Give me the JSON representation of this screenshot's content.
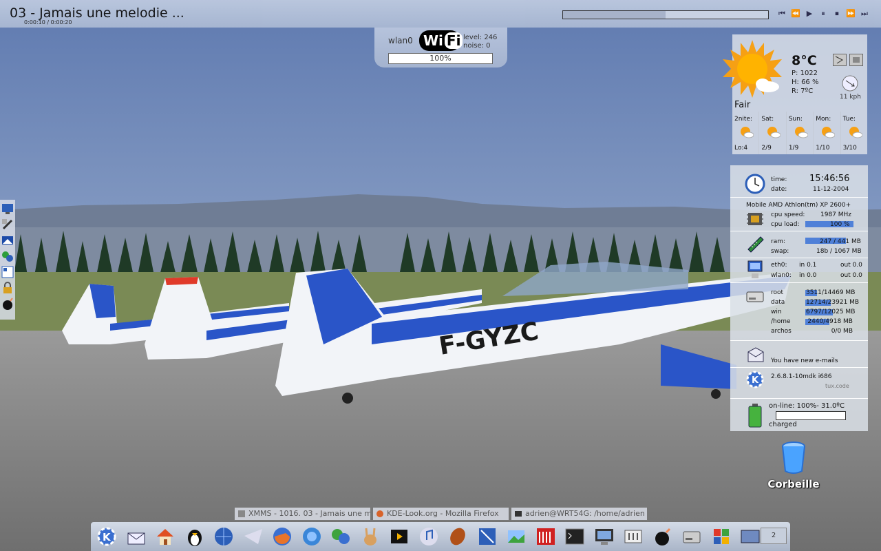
{
  "player": {
    "title": "03 - Jamais une melodie ...",
    "time": "0:00:10 / 0:00:20",
    "seek_progress": 0.5,
    "controls": [
      "⏮",
      "⏪",
      "▶",
      "⏸",
      "⏹",
      "⏩",
      "⏭"
    ]
  },
  "wifi": {
    "iface": "wlan0",
    "logo_a": "Wi",
    "logo_b": "Fi",
    "level": "level: 246",
    "noise": "noise: 0",
    "quality": "100%"
  },
  "weather": {
    "temp": "8°C",
    "pressure": "P: 1022",
    "humidity": "H: 66 %",
    "dew": "R: 7ºC",
    "wind": "11 kph",
    "condition": "Fair",
    "forecast": [
      {
        "day": "2nite:",
        "val": "Lo:4"
      },
      {
        "day": "Sat:",
        "val": "2/9"
      },
      {
        "day": "Sun:",
        "val": "1/9"
      },
      {
        "day": "Mon:",
        "val": "1/10"
      },
      {
        "day": "Tue:",
        "val": "3/10"
      }
    ]
  },
  "sysmon": {
    "time_label": "time:",
    "time": "15:46:56",
    "date_label": "date:",
    "date": "11-12-2004",
    "cpu_name": "Mobile AMD Athlon(tm) XP 2600+",
    "cpu_speed_label": "cpu speed:",
    "cpu_speed": "1987 MHz",
    "cpu_load_label": "cpu load:",
    "cpu_load": "100 %",
    "ram_label": "ram:",
    "ram": "247 / 441 MB",
    "swap_label": "swap:",
    "swap": "18b / 1067 MB",
    "eth_label": "eth0:",
    "eth_in": "in 0.1",
    "eth_out": "out 0.0",
    "wlan_label": "wlan0:",
    "wlan_in": "in 0.0",
    "wlan_out": "out 0.0",
    "disks": [
      {
        "name": "root",
        "val": "3511/14469 MB"
      },
      {
        "name": "data",
        "val": "12714/23921 MB"
      },
      {
        "name": "win",
        "val": "6797/12025 MB"
      },
      {
        "name": "/home",
        "val": "2440/4918 MB"
      },
      {
        "name": "archos",
        "val": "0/0 MB"
      }
    ],
    "mail": "You have  new e-mails",
    "kernel": "2.6.8.1-10mdk i686",
    "host": "tux.code",
    "battery": "on-line: 100%- 31.0ºC",
    "battery_state": "charged"
  },
  "trash": {
    "label": "Corbeille"
  },
  "tasks": [
    {
      "label": "XMMS - 1016. 03 - Jamais une melodie"
    },
    {
      "label": "KDE-Look.org - Mozilla Firefox"
    },
    {
      "label": "adrien@WRT54G: /home/adrien"
    }
  ],
  "pager": {
    "label": "2"
  }
}
